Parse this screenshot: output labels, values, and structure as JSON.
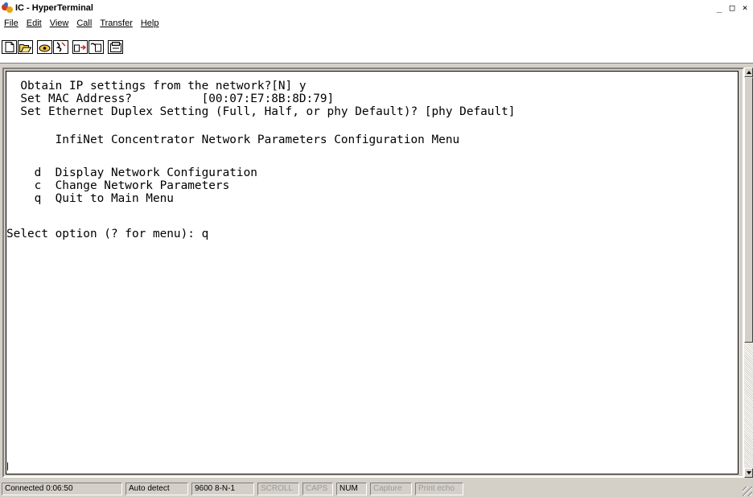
{
  "window": {
    "title": "IC - HyperTerminal",
    "controls": [
      "_",
      "□",
      "×"
    ]
  },
  "menubar": {
    "items": [
      {
        "label": "File",
        "underline": "F"
      },
      {
        "label": "Edit",
        "underline": "E"
      },
      {
        "label": "View",
        "underline": "V"
      },
      {
        "label": "Call",
        "underline": "C"
      },
      {
        "label": "Transfer",
        "underline": "T"
      },
      {
        "label": "Help",
        "underline": "H"
      }
    ]
  },
  "toolbar": {
    "icons": [
      "new-icon",
      "open-icon",
      "connect-icon",
      "disconnect-icon",
      "send-icon",
      "receive-icon",
      "properties-icon"
    ]
  },
  "terminal": {
    "lines": [
      "  Obtain IP settings from the network?[N] y",
      "  Set MAC Address?          [00:07:E7:8B:8D:79]",
      "  Set Ethernet Duplex Setting (Full, Half, or phy Default)? [phy Default]",
      "",
      "       InfiNet Concentrator Network Parameters Configuration Menu",
      "",
      "    d  Display Network Configuration",
      "    c  Change Network Parameters",
      "    q  Quit to Main Menu",
      "",
      "Select option (? for menu): q"
    ]
  },
  "statusbar": {
    "connected": "Connected 0:06:50",
    "detect": "Auto detect",
    "settings": "9600 8-N-1",
    "scroll": "SCROLL",
    "caps": "CAPS",
    "num": "NUM",
    "capture": "Capture",
    "print_echo": "Print echo"
  }
}
